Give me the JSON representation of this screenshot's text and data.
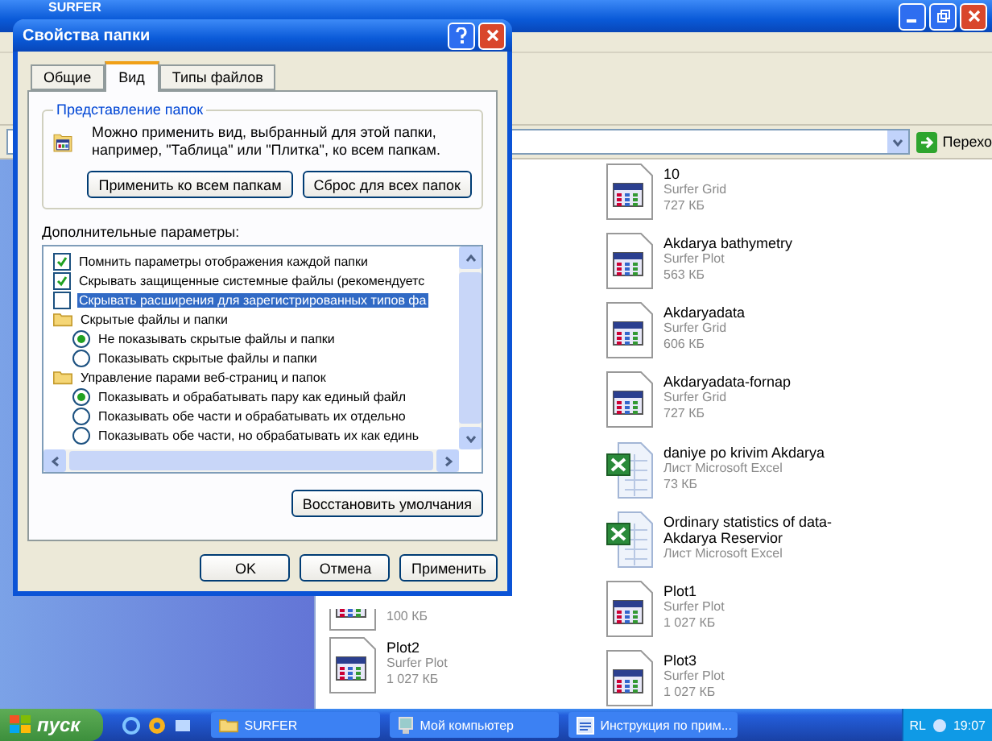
{
  "explorer": {
    "title": "SURFER",
    "address_button": "Перехо",
    "files_left": [
      {
        "kind": "grid",
        "size": "100 КБ"
      },
      {
        "kind": "grid",
        "name": "Plot2",
        "desc": "Surfer Plot",
        "size": "1 027 КБ"
      }
    ],
    "files_right": [
      {
        "kind": "grid",
        "name": "10",
        "desc": "Surfer Grid",
        "size": "727 КБ"
      },
      {
        "kind": "grid",
        "name": "Akdarya bathymetry",
        "desc": "Surfer Plot",
        "size": "563 КБ"
      },
      {
        "kind": "grid",
        "name": "Akdaryadata",
        "desc": "Surfer Grid",
        "size": "606 КБ"
      },
      {
        "kind": "grid",
        "name": "Akdaryadata-fornap",
        "desc": "Surfer Grid",
        "size": "727 КБ"
      },
      {
        "kind": "excel",
        "name": "daniye po krivim Akdarya",
        "desc": "Лист Microsoft Excel",
        "size": "73 КБ"
      },
      {
        "kind": "excel",
        "name": "Ordinary statistics of data-Akdarya Reservior",
        "desc": "Лист Microsoft Excel"
      },
      {
        "kind": "grid",
        "name": "Plot1",
        "desc": "Surfer Plot",
        "size": "1 027 КБ"
      },
      {
        "kind": "grid",
        "name": "Plot3",
        "desc": "Surfer Plot",
        "size": "1 027 КБ"
      }
    ]
  },
  "dialog": {
    "title": "Свойства папки",
    "tabs": [
      {
        "label": "Общие",
        "selected": false
      },
      {
        "label": "Вид",
        "selected": true
      },
      {
        "label": "Типы файлов",
        "selected": false
      }
    ],
    "group_title": "Представление папок",
    "group_text": "Можно применить вид, выбранный для этой папки, например, \"Таблица\" или \"Плитка\", ко всем папкам.",
    "group_buttons": [
      "Применить ко всем папкам",
      "Сброс для всех папок"
    ],
    "advanced_label": "Дополнительные параметры:",
    "options": [
      {
        "kind": "checkbox",
        "label": "Помнить параметры отображения каждой папки",
        "checked": true,
        "selected": false
      },
      {
        "kind": "checkbox",
        "label": "Скрывать защищенные системные файлы (рекомендуетс",
        "checked": true,
        "selected": false
      },
      {
        "kind": "checkbox",
        "label": "Скрывать расширения для зарегистрированных типов фа",
        "checked": false,
        "selected": true
      },
      {
        "kind": "folder",
        "label": "Скрытые файлы и папки",
        "children": [
          {
            "kind": "radio",
            "label": "Не показывать скрытые файлы и папки",
            "checked": true
          },
          {
            "kind": "radio",
            "label": "Показывать скрытые файлы и папки",
            "checked": false
          }
        ]
      },
      {
        "kind": "folder",
        "label": "Управление парами веб-страниц и папок",
        "children": [
          {
            "kind": "radio",
            "label": "Показывать и обрабатывать пару как единый файл",
            "checked": true
          },
          {
            "kind": "radio",
            "label": "Показывать обе части и обрабатывать их отдельно",
            "checked": false
          },
          {
            "kind": "radio",
            "label": "Показывать обе части, но обрабатывать их как единь",
            "checked": false
          }
        ]
      }
    ],
    "restore_button": "Восстановить умолчания",
    "buttons": [
      "OK",
      "Отмена",
      "Применить"
    ]
  },
  "taskbar": {
    "start": "пуск",
    "tasks": [
      {
        "label": "SURFER",
        "kind": "folder"
      },
      {
        "label": "Мой компьютер",
        "kind": "computer"
      },
      {
        "label": "Инструкция по прим...",
        "kind": "doc"
      }
    ],
    "lang": "RL",
    "clock": "19:07"
  }
}
